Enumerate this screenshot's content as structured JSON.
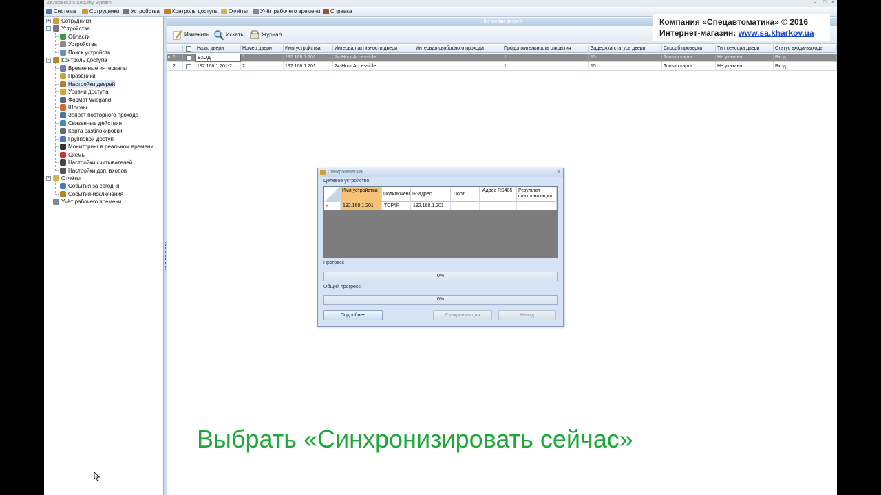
{
  "window": {
    "title": "ZKAccess3.5 Security System"
  },
  "menu": [
    {
      "label": "Система",
      "icon": "system-icon",
      "color": "#4a79c4"
    },
    {
      "label": "Сотрудники",
      "icon": "employees-icon",
      "color": "#d19a36"
    },
    {
      "label": "Устройства",
      "icon": "devices-icon",
      "color": "#777777"
    },
    {
      "label": "Контроль доступа",
      "icon": "access-control-icon",
      "color": "#b8842c"
    },
    {
      "label": "Отчёты",
      "icon": "reports-icon",
      "color": "#d6b24a"
    },
    {
      "label": "Учёт рабочего времени",
      "icon": "attendance-icon",
      "color": "#7a8a9c"
    },
    {
      "label": "Справка",
      "icon": "help-icon",
      "color": "#a0522d"
    }
  ],
  "tree": [
    {
      "label": "Сотрудники",
      "level": 0,
      "expander": "+",
      "icon": "employees-icon",
      "color": "#d19a36"
    },
    {
      "label": "Устройства",
      "level": 0,
      "expander": "-",
      "icon": "devices-icon",
      "color": "#777777"
    },
    {
      "label": "Области",
      "level": 1,
      "icon": "areas-icon",
      "color": "#3d9a3d"
    },
    {
      "label": "Устройства",
      "level": 1,
      "icon": "device-icon",
      "color": "#8c8c8c"
    },
    {
      "label": "Поиск устройств",
      "level": 1,
      "icon": "device-search-icon",
      "color": "#6d8fb8"
    },
    {
      "label": "Контроль доступа",
      "level": 0,
      "expander": "-",
      "icon": "access-control-icon",
      "color": "#b8842c"
    },
    {
      "label": "Временные интервалы",
      "level": 1,
      "icon": "time-zones-icon",
      "color": "#6a7fa8"
    },
    {
      "label": "Праздники",
      "level": 1,
      "icon": "holidays-icon",
      "color": "#c9a33a"
    },
    {
      "label": "Настройки дверей",
      "level": 1,
      "icon": "door-settings-icon",
      "color": "#c07a2a",
      "selected": true
    },
    {
      "label": "Уровни доступа",
      "level": 1,
      "icon": "access-levels-icon",
      "color": "#d8a33a"
    },
    {
      "label": "Формат Wiegand",
      "level": 1,
      "icon": "wiegand-icon",
      "color": "#556b85"
    },
    {
      "label": "Шлюзы",
      "level": 1,
      "icon": "interlock-icon",
      "color": "#d9672a"
    },
    {
      "label": "Запрет повторного прохода",
      "level": 1,
      "icon": "antipassback-icon",
      "color": "#4d72b0"
    },
    {
      "label": "Связанные действия",
      "level": 1,
      "icon": "linkage-icon",
      "color": "#3e8ac8"
    },
    {
      "label": "Карта разблокировки",
      "level": 1,
      "icon": "unlock-card-icon",
      "color": "#6b6b6b"
    },
    {
      "label": "Групповой доступ",
      "level": 1,
      "icon": "multi-card-icon",
      "color": "#4a7ab8"
    },
    {
      "label": "Мониторинг в реальном времени",
      "level": 1,
      "icon": "monitoring-icon",
      "color": "#333333"
    },
    {
      "label": "Схемы",
      "level": 1,
      "icon": "maps-icon",
      "color": "#c23a2a"
    },
    {
      "label": "Настройки считывателей",
      "level": 1,
      "icon": "reader-settings-icon",
      "color": "#444444"
    },
    {
      "label": "Настройки доп. входов",
      "level": 1,
      "icon": "aux-input-icon",
      "color": "#555555"
    },
    {
      "label": "Отчёты",
      "level": 0,
      "expander": "-",
      "icon": "reports-icon",
      "color": "#d6b24a"
    },
    {
      "label": "События за сегодня",
      "level": 1,
      "icon": "today-events-icon",
      "color": "#4a7ab8"
    },
    {
      "label": "События-исключения",
      "level": 1,
      "icon": "exception-events-icon",
      "color": "#b8842c"
    },
    {
      "label": "Учёт рабочего времени",
      "level": 0,
      "icon": "attendance-icon",
      "color": "#7a8a9c"
    }
  ],
  "panel": {
    "header": "Настройки дверей"
  },
  "toolbar": [
    {
      "label": "Изменить",
      "icon": "edit-icon"
    },
    {
      "label": "Искать",
      "icon": "search-icon"
    },
    {
      "label": "Журнал",
      "icon": "log-icon"
    }
  ],
  "grid": {
    "columns": [
      "Назв. двери",
      "Номер двери",
      "Имя устройства",
      "Интервал активности двери",
      "Интервал свободного прохода",
      "Продолжительность открытия",
      "Задержка статуса двери",
      "Способ проверки",
      "Тип сенсора двери",
      "Статус входа-выхода"
    ],
    "rows": [
      {
        "num": "1",
        "cells": [
          "ВХОД",
          "1",
          "192.168.1.201",
          "24-Hour Accessible",
          "",
          "1",
          "15",
          "Только карта",
          "Не указано",
          "Вход"
        ],
        "selected": true
      },
      {
        "num": "2",
        "cells": [
          "192.168.1.201-2",
          "2",
          "192.168.1.201",
          "24-Hour Accessible",
          "",
          "1",
          "15",
          "Только карта",
          "Не указано",
          "Вход"
        ]
      }
    ]
  },
  "dialog": {
    "title": "Синхронизация",
    "target_label": "Целевое устройство",
    "columns": [
      "Имя устройства",
      "Подключение",
      "IP-адрес",
      "Порт",
      "Адрес RS485",
      "Результат синхронизации"
    ],
    "rows": [
      [
        "192.168.1.201",
        "TCP/IP",
        "192.168.1.201",
        "",
        "",
        ""
      ]
    ],
    "progress_label": "Прогресс",
    "progress_value": "0%",
    "total_label": "Общий прогресс",
    "total_value": "0%",
    "btn_details": "Подробнее",
    "btn_sync": "Синхронизация",
    "btn_back": "Назад"
  },
  "promo": {
    "line1": "Компания «Спецавтоматика» © 2016",
    "line2_prefix": "Интернет-магазин: ",
    "url": "www.sa.kharkov.ua"
  },
  "caption": "Выбрать «Синхронизировать сейчас»"
}
